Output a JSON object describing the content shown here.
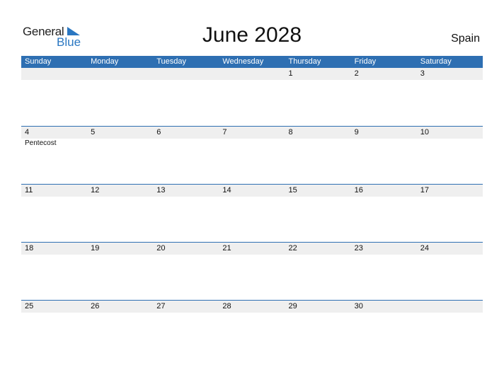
{
  "logo": {
    "general": "General",
    "blue": "Blue"
  },
  "title": "June 2028",
  "country": "Spain",
  "colors": {
    "header_bg": "#2e6fb2",
    "date_strip_bg": "#efefef",
    "logo_blue": "#2a77c2"
  },
  "weekdays": [
    "Sunday",
    "Monday",
    "Tuesday",
    "Wednesday",
    "Thursday",
    "Friday",
    "Saturday"
  ],
  "weeks": [
    {
      "days": [
        "",
        "",
        "",
        "",
        "1",
        "2",
        "3"
      ],
      "events": [
        "",
        "",
        "",
        "",
        "",
        "",
        ""
      ]
    },
    {
      "days": [
        "4",
        "5",
        "6",
        "7",
        "8",
        "9",
        "10"
      ],
      "events": [
        "Pentecost",
        "",
        "",
        "",
        "",
        "",
        ""
      ]
    },
    {
      "days": [
        "11",
        "12",
        "13",
        "14",
        "15",
        "16",
        "17"
      ],
      "events": [
        "",
        "",
        "",
        "",
        "",
        "",
        ""
      ]
    },
    {
      "days": [
        "18",
        "19",
        "20",
        "21",
        "22",
        "23",
        "24"
      ],
      "events": [
        "",
        "",
        "",
        "",
        "",
        "",
        ""
      ]
    },
    {
      "days": [
        "25",
        "26",
        "27",
        "28",
        "29",
        "30",
        ""
      ],
      "events": [
        "",
        "",
        "",
        "",
        "",
        "",
        ""
      ]
    }
  ]
}
